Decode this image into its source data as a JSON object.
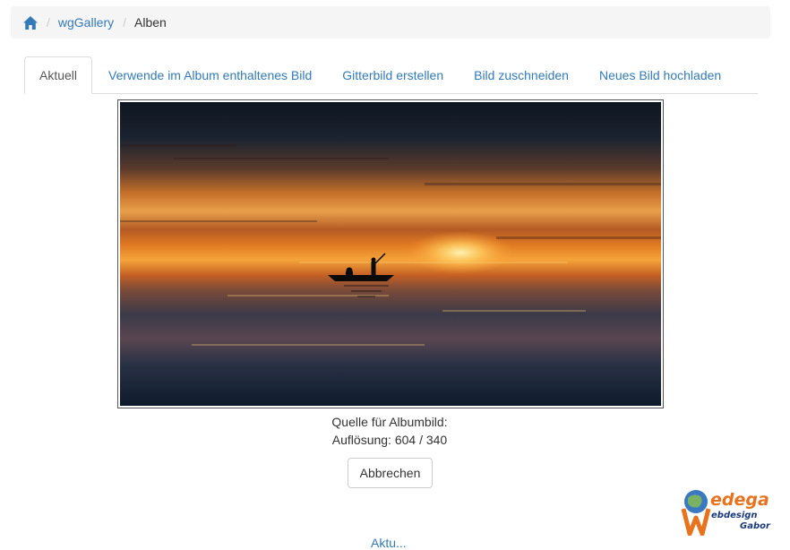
{
  "breadcrumb": {
    "home_icon": "home-icon",
    "items": [
      "wgGallery",
      "Alben"
    ]
  },
  "tabs": [
    {
      "label": "Aktuell",
      "active": true
    },
    {
      "label": "Verwende im Album enthaltenes Bild",
      "active": false
    },
    {
      "label": "Gitterbild erstellen",
      "active": false
    },
    {
      "label": "Bild zuschneiden",
      "active": false
    },
    {
      "label": "Neues Bild hochladen",
      "active": false
    }
  ],
  "image": {
    "description_icon": "sunset-boat-image"
  },
  "info": {
    "source_label": "Quelle für Albumbild:",
    "resolution_label": "Auflösung: 604 / 340"
  },
  "buttons": {
    "cancel": "Abbrechen"
  },
  "footer": {
    "partial_link": "Aktu..."
  },
  "logo": {
    "line1": "edega",
    "line2": "ebdesign",
    "line3": "Gabor"
  },
  "colors": {
    "link": "#337ab7",
    "breadcrumb_bg": "#f5f5f5"
  }
}
